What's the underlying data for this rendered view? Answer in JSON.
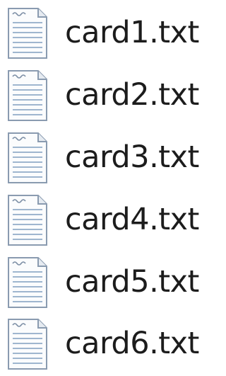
{
  "files": [
    {
      "name": "card1.txt",
      "icon": "text-file-icon"
    },
    {
      "name": "card2.txt",
      "icon": "text-file-icon"
    },
    {
      "name": "card3.txt",
      "icon": "text-file-icon"
    },
    {
      "name": "card4.txt",
      "icon": "text-file-icon"
    },
    {
      "name": "card5.txt",
      "icon": "text-file-icon"
    },
    {
      "name": "card6.txt",
      "icon": "text-file-icon"
    }
  ],
  "colors": {
    "background": "#ffffff",
    "text": "#1c1c1c",
    "icon_outline": "#8a9bb0",
    "icon_lines": "#9fb6cf"
  }
}
